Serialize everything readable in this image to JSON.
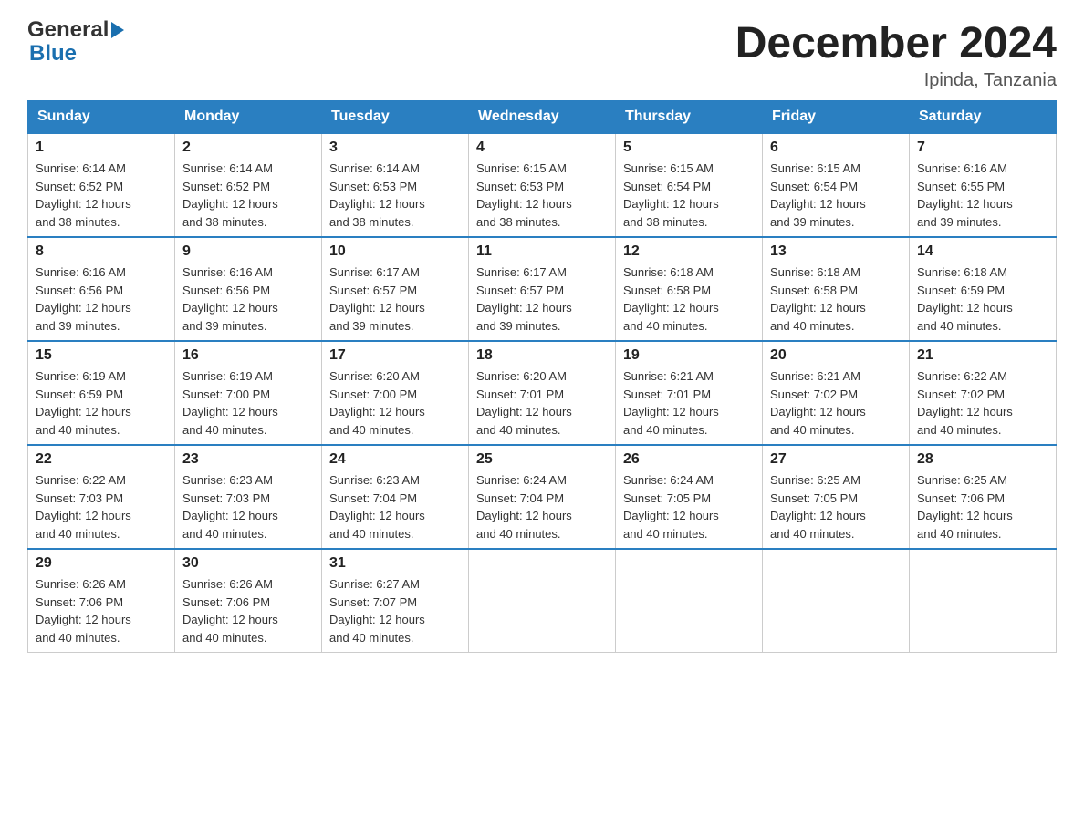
{
  "logo": {
    "text_general": "General",
    "text_blue": "Blue",
    "triangle_symbol": "▶"
  },
  "header": {
    "month_title": "December 2024",
    "location": "Ipinda, Tanzania"
  },
  "days_of_week": [
    "Sunday",
    "Monday",
    "Tuesday",
    "Wednesday",
    "Thursday",
    "Friday",
    "Saturday"
  ],
  "weeks": [
    [
      {
        "day": "1",
        "sunrise": "6:14 AM",
        "sunset": "6:52 PM",
        "daylight": "12 hours and 38 minutes."
      },
      {
        "day": "2",
        "sunrise": "6:14 AM",
        "sunset": "6:52 PM",
        "daylight": "12 hours and 38 minutes."
      },
      {
        "day": "3",
        "sunrise": "6:14 AM",
        "sunset": "6:53 PM",
        "daylight": "12 hours and 38 minutes."
      },
      {
        "day": "4",
        "sunrise": "6:15 AM",
        "sunset": "6:53 PM",
        "daylight": "12 hours and 38 minutes."
      },
      {
        "day": "5",
        "sunrise": "6:15 AM",
        "sunset": "6:54 PM",
        "daylight": "12 hours and 38 minutes."
      },
      {
        "day": "6",
        "sunrise": "6:15 AM",
        "sunset": "6:54 PM",
        "daylight": "12 hours and 39 minutes."
      },
      {
        "day": "7",
        "sunrise": "6:16 AM",
        "sunset": "6:55 PM",
        "daylight": "12 hours and 39 minutes."
      }
    ],
    [
      {
        "day": "8",
        "sunrise": "6:16 AM",
        "sunset": "6:56 PM",
        "daylight": "12 hours and 39 minutes."
      },
      {
        "day": "9",
        "sunrise": "6:16 AM",
        "sunset": "6:56 PM",
        "daylight": "12 hours and 39 minutes."
      },
      {
        "day": "10",
        "sunrise": "6:17 AM",
        "sunset": "6:57 PM",
        "daylight": "12 hours and 39 minutes."
      },
      {
        "day": "11",
        "sunrise": "6:17 AM",
        "sunset": "6:57 PM",
        "daylight": "12 hours and 39 minutes."
      },
      {
        "day": "12",
        "sunrise": "6:18 AM",
        "sunset": "6:58 PM",
        "daylight": "12 hours and 40 minutes."
      },
      {
        "day": "13",
        "sunrise": "6:18 AM",
        "sunset": "6:58 PM",
        "daylight": "12 hours and 40 minutes."
      },
      {
        "day": "14",
        "sunrise": "6:18 AM",
        "sunset": "6:59 PM",
        "daylight": "12 hours and 40 minutes."
      }
    ],
    [
      {
        "day": "15",
        "sunrise": "6:19 AM",
        "sunset": "6:59 PM",
        "daylight": "12 hours and 40 minutes."
      },
      {
        "day": "16",
        "sunrise": "6:19 AM",
        "sunset": "7:00 PM",
        "daylight": "12 hours and 40 minutes."
      },
      {
        "day": "17",
        "sunrise": "6:20 AM",
        "sunset": "7:00 PM",
        "daylight": "12 hours and 40 minutes."
      },
      {
        "day": "18",
        "sunrise": "6:20 AM",
        "sunset": "7:01 PM",
        "daylight": "12 hours and 40 minutes."
      },
      {
        "day": "19",
        "sunrise": "6:21 AM",
        "sunset": "7:01 PM",
        "daylight": "12 hours and 40 minutes."
      },
      {
        "day": "20",
        "sunrise": "6:21 AM",
        "sunset": "7:02 PM",
        "daylight": "12 hours and 40 minutes."
      },
      {
        "day": "21",
        "sunrise": "6:22 AM",
        "sunset": "7:02 PM",
        "daylight": "12 hours and 40 minutes."
      }
    ],
    [
      {
        "day": "22",
        "sunrise": "6:22 AM",
        "sunset": "7:03 PM",
        "daylight": "12 hours and 40 minutes."
      },
      {
        "day": "23",
        "sunrise": "6:23 AM",
        "sunset": "7:03 PM",
        "daylight": "12 hours and 40 minutes."
      },
      {
        "day": "24",
        "sunrise": "6:23 AM",
        "sunset": "7:04 PM",
        "daylight": "12 hours and 40 minutes."
      },
      {
        "day": "25",
        "sunrise": "6:24 AM",
        "sunset": "7:04 PM",
        "daylight": "12 hours and 40 minutes."
      },
      {
        "day": "26",
        "sunrise": "6:24 AM",
        "sunset": "7:05 PM",
        "daylight": "12 hours and 40 minutes."
      },
      {
        "day": "27",
        "sunrise": "6:25 AM",
        "sunset": "7:05 PM",
        "daylight": "12 hours and 40 minutes."
      },
      {
        "day": "28",
        "sunrise": "6:25 AM",
        "sunset": "7:06 PM",
        "daylight": "12 hours and 40 minutes."
      }
    ],
    [
      {
        "day": "29",
        "sunrise": "6:26 AM",
        "sunset": "7:06 PM",
        "daylight": "12 hours and 40 minutes."
      },
      {
        "day": "30",
        "sunrise": "6:26 AM",
        "sunset": "7:06 PM",
        "daylight": "12 hours and 40 minutes."
      },
      {
        "day": "31",
        "sunrise": "6:27 AM",
        "sunset": "7:07 PM",
        "daylight": "12 hours and 40 minutes."
      },
      null,
      null,
      null,
      null
    ]
  ],
  "labels": {
    "sunrise": "Sunrise:",
    "sunset": "Sunset:",
    "daylight": "Daylight:"
  }
}
